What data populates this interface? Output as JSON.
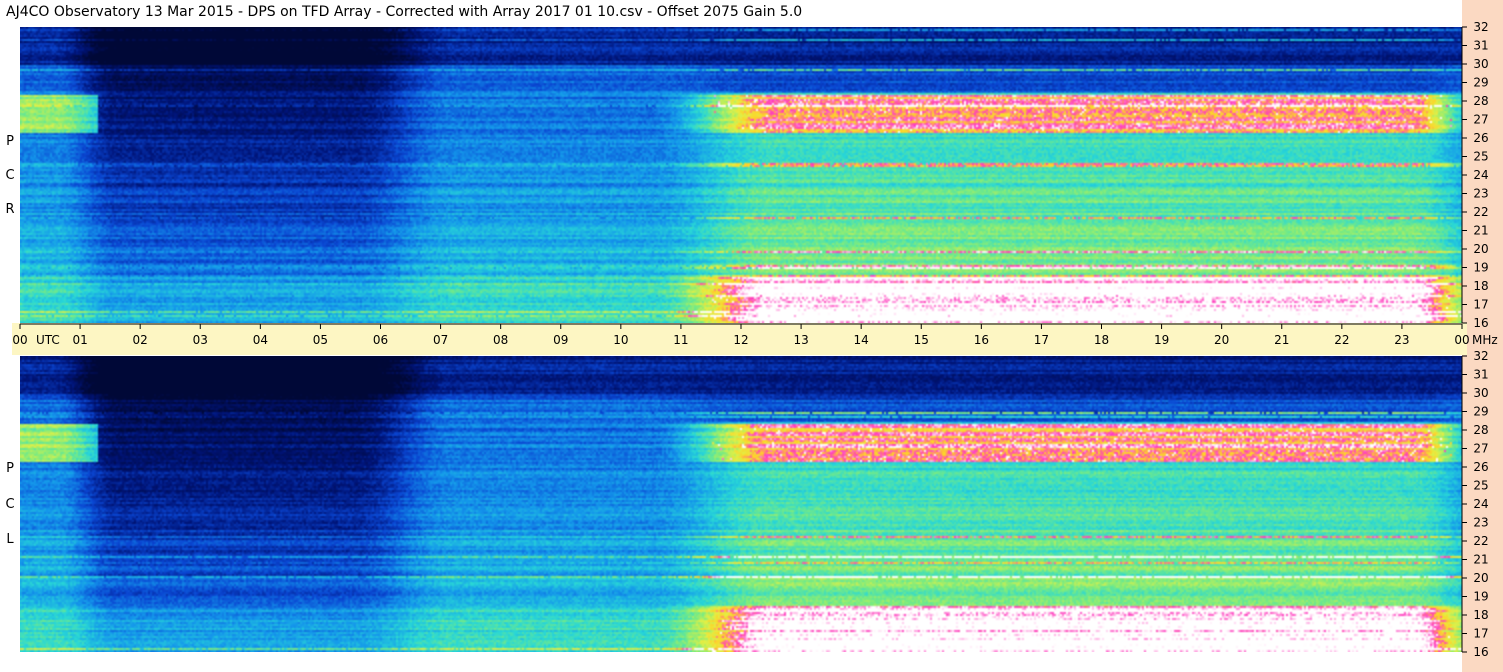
{
  "title": "AJ4CO Observatory  13 Mar 2015  -  DPS on TFD Array  -  Corrected with Array 2017 01 10.csv  -  Offset 2075  Gain 5.0",
  "panels": [
    {
      "id": "rcp",
      "letters": [
        "P",
        "C",
        "R"
      ]
    },
    {
      "id": "lcp",
      "letters": [
        "P",
        "C",
        "L"
      ]
    }
  ],
  "colors": {
    "spectrogram_low": "#000a3c",
    "spectrogram_high": "#ff33cc",
    "time_band": "#fdf6c3",
    "right_band": "#fbd9c2"
  },
  "chart_data": {
    "type": "heatmap",
    "title": "AJ4CO Observatory  13 Mar 2015  -  DPS on TFD Array  -  Corrected with Array 2017 01 10.csv  -  Offset 2075  Gain 5.0",
    "x_unit_label": "UTC",
    "y_unit_label": "MHz",
    "x_range": [
      0,
      24
    ],
    "x_ticks": [
      "00",
      "01",
      "02",
      "03",
      "04",
      "05",
      "06",
      "07",
      "08",
      "09",
      "10",
      "11",
      "12",
      "13",
      "14",
      "15",
      "16",
      "17",
      "18",
      "19",
      "20",
      "21",
      "22",
      "23",
      "00"
    ],
    "y_range": [
      16,
      32
    ],
    "y_ticks": [
      16,
      17,
      18,
      19,
      20,
      21,
      22,
      23,
      24,
      25,
      26,
      27,
      28,
      29,
      30,
      31,
      32
    ],
    "panels": [
      "RCP",
      "LCP"
    ],
    "legend": "none"
  }
}
